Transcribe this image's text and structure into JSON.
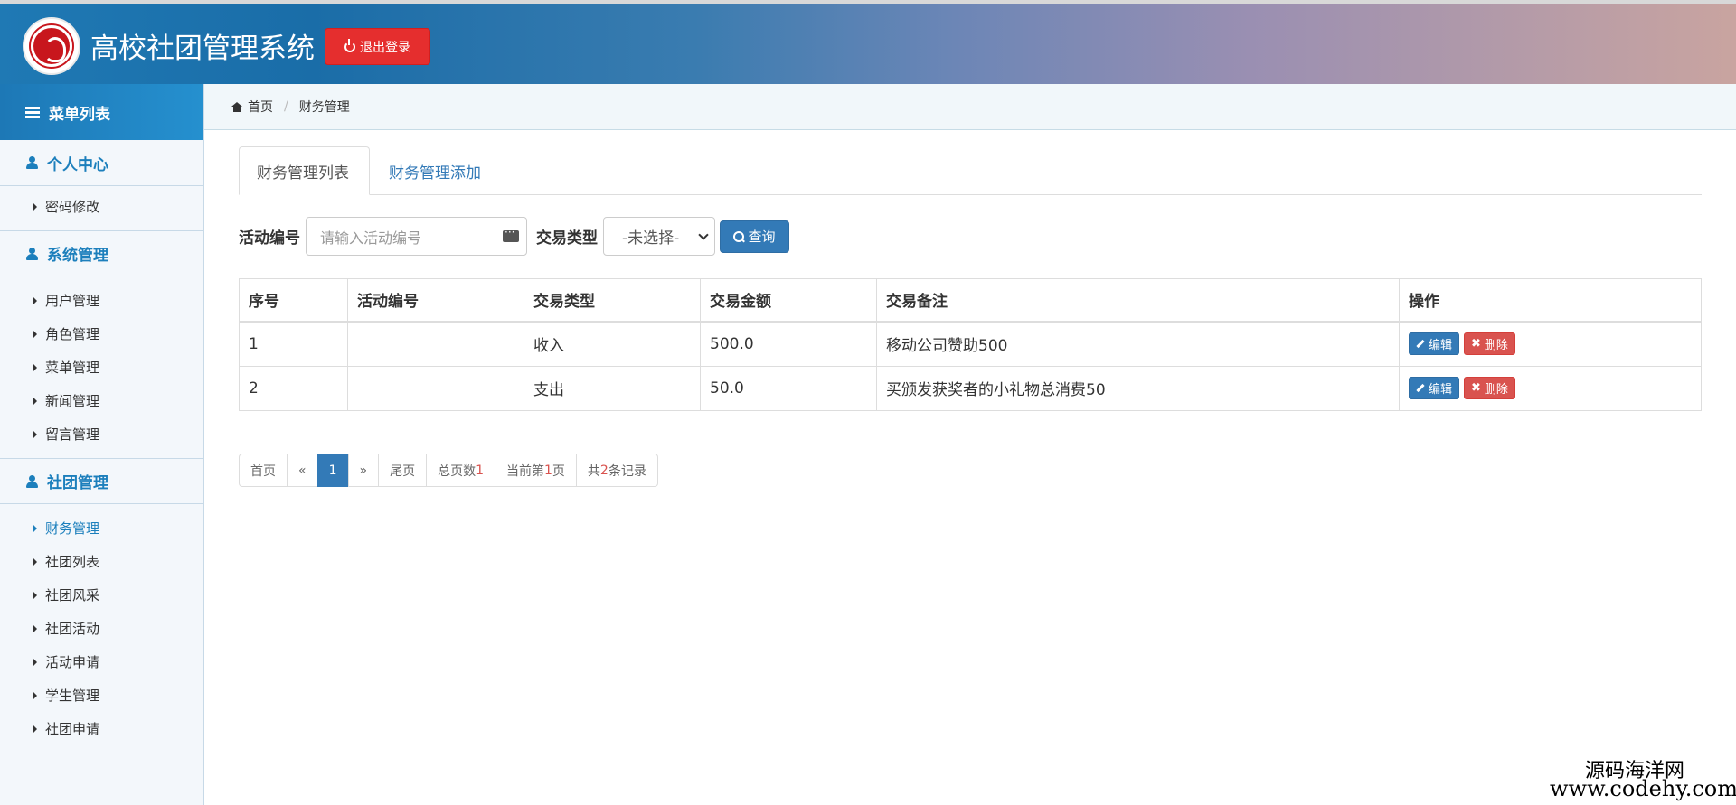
{
  "header": {
    "app_title": "高校社团管理系统",
    "logout_label": "退出登录"
  },
  "sidebar": {
    "menu_title": "菜单列表",
    "groups": [
      {
        "title": "个人中心",
        "items": [
          "密码修改"
        ]
      },
      {
        "title": "系统管理",
        "items": [
          "用户管理",
          "角色管理",
          "菜单管理",
          "新闻管理",
          "留言管理"
        ]
      },
      {
        "title": "社团管理",
        "items": [
          "财务管理",
          "社团列表",
          "社团风采",
          "社团活动",
          "活动申请",
          "学生管理",
          "社团申请"
        ]
      }
    ],
    "active_item": "财务管理"
  },
  "breadcrumb": {
    "home": "首页",
    "current": "财务管理"
  },
  "tabs": {
    "list": "财务管理列表",
    "add": "财务管理添加"
  },
  "search": {
    "activity_label": "活动编号",
    "activity_placeholder": "请输入活动编号",
    "type_label": "交易类型",
    "type_selected": "-未选择-",
    "query_label": "查询"
  },
  "table": {
    "headers": [
      "序号",
      "活动编号",
      "交易类型",
      "交易金额",
      "交易备注",
      "操作"
    ],
    "rows": [
      {
        "no": "1",
        "activity": "",
        "type": "收入",
        "amount": "500.0",
        "note": "移动公司赞助500"
      },
      {
        "no": "2",
        "activity": "",
        "type": "支出",
        "amount": "50.0",
        "note": "买颁发获奖者的小礼物总消费50"
      }
    ],
    "edit_label": "编辑",
    "delete_label": "删除"
  },
  "pagination": {
    "first": "首页",
    "prev": "«",
    "current": "1",
    "next": "»",
    "last": "尾页",
    "total_pages_prefix": "总页数",
    "total_pages": "1",
    "current_page_prefix": "当前第",
    "current_page": "1",
    "current_page_suffix": "页",
    "records_prefix": "共",
    "records": "2",
    "records_suffix": "条记录"
  },
  "watermark": {
    "line1": "源码海洋网",
    "line2": "www.codehy.com"
  }
}
